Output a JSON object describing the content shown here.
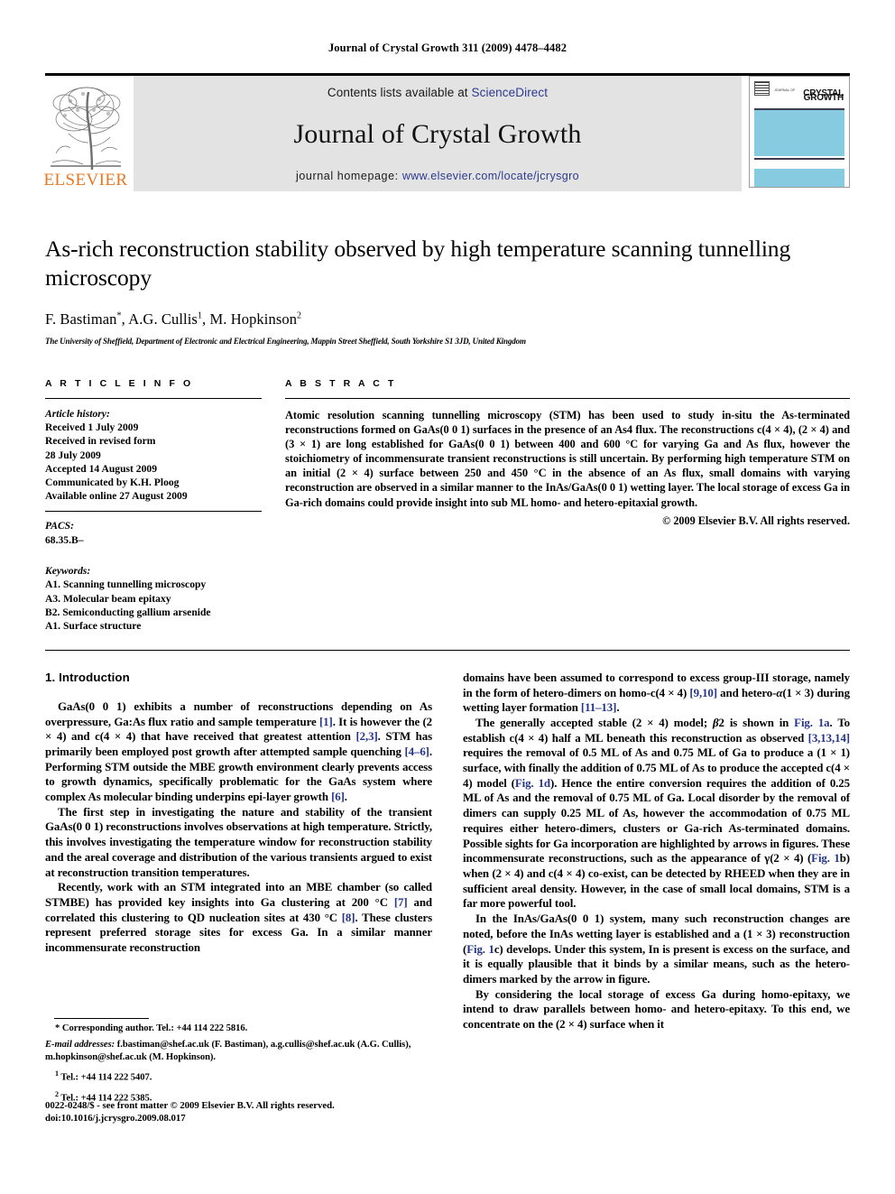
{
  "running_head": "Journal of Crystal Growth 311 (2009) 4478–4482",
  "masthead": {
    "publisher_name": "ELSEVIER",
    "contents_prefix": "Contents lists available at ",
    "contents_link": "ScienceDirect",
    "journal_name": "Journal of Crystal Growth",
    "homepage_prefix": "journal homepage: ",
    "homepage_link": "www.elsevier.com/locate/jcrysgro",
    "cover": {
      "kicker": "JOURNAL OF",
      "line1": "CRYSTAL",
      "line2": "GROWTH",
      "band_color": "#86cbe0"
    },
    "link_color": "#2b3a8f",
    "elsevier_orange": "#E87722"
  },
  "article": {
    "title": "As-rich reconstruction stability observed by high temperature scanning tunnelling microscopy",
    "authors_html": "F. Bastiman *, A.G. Cullis 1, M. Hopkinson 2",
    "affiliation": "The University of Sheffield, Department of Electronic and Electrical Engineering, Mappin Street Sheffield, South Yorkshire S1 3JD, United Kingdom"
  },
  "article_info": {
    "heading": "A R T I C L E    I N F O",
    "history_label": "Article history:",
    "history": [
      "Received 1 July 2009",
      "Received in revised form",
      "28 July 2009",
      "Accepted 14 August 2009",
      "Communicated by K.H. Ploog",
      "Available online 27 August 2009"
    ],
    "pacs_label": "PACS:",
    "pacs": [
      "68.35.B–"
    ],
    "keywords_label": "Keywords:",
    "keywords": [
      "A1. Scanning tunnelling microscopy",
      "A3. Molecular beam epitaxy",
      "B2. Semiconducting gallium arsenide",
      "A1. Surface structure"
    ]
  },
  "abstract": {
    "heading": "A B S T R A C T",
    "text": "Atomic resolution scanning tunnelling microscopy (STM) has been used to study in-situ the As-terminated reconstructions formed on GaAs(0 0 1) surfaces in the presence of an As4 flux. The reconstructions c(4 × 4), (2 × 4) and (3 × 1) are long established for GaAs(0 0 1) between 400 and 600 °C for varying Ga and As flux, however the stoichiometry of incommensurate transient reconstructions is still uncertain. By performing high temperature STM on an initial (2 × 4) surface between 250 and 450 °C in the absence of an As flux, small domains with varying reconstruction are observed in a similar manner to the InAs/GaAs(0 0 1) wetting layer. The local storage of excess Ga in Ga-rich domains could provide insight into sub ML homo- and hetero-epitaxial growth.",
    "copyright": "© 2009 Elsevier B.V. All rights reserved."
  },
  "body": {
    "section_heading": "1. Introduction",
    "left_paragraphs": [
      "GaAs(0 0 1) exhibits a number of reconstructions depending on As overpressure, Ga:As flux ratio and sample temperature [1]. It is however the (2 × 4) and c(4 × 4) that have received that greatest attention [2,3]. STM has primarily been employed post growth after attempted sample quenching [4–6]. Performing STM outside the MBE growth environment clearly prevents access to growth dynamics, specifically problematic for the GaAs system where complex As molecular binding underpins epi-layer growth [6].",
      "The first step in investigating the nature and stability of the transient GaAs(0 0 1) reconstructions involves observations at high temperature. Strictly, this involves investigating the temperature window for reconstruction stability and the areal coverage and distribution of the various transients argued to exist at reconstruction transition temperatures.",
      "Recently, work with an STM integrated into an MBE chamber (so called STMBE) has provided key insights into Ga clustering at 200 °C [7] and correlated this clustering to QD nucleation sites at 430 °C [8]. These clusters represent preferred storage sites for excess Ga. In a similar manner incommensurate reconstruction"
    ],
    "right_paragraphs": [
      "domains have been assumed to correspond to excess group-III storage, namely in the form of hetero-dimers on homo-c(4 × 4) [9,10] and hetero-α(1 × 3) during wetting layer formation [11–13].",
      "The generally accepted stable (2 × 4) model; β2 is shown in Fig. 1a. To establish c(4 × 4) half a ML beneath this reconstruction as observed [3,13,14] requires the removal of 0.5 ML of As and 0.75 ML of Ga to produce a (1 × 1) surface, with finally the addition of 0.75 ML of As to produce the accepted c(4 × 4) model (Fig. 1d). Hence the entire conversion requires the addition of 0.25 ML of As and the removal of 0.75 ML of Ga. Local disorder by the removal of dimers can supply 0.25 ML of As, however the accommodation of 0.75 ML requires either hetero-dimers, clusters or Ga-rich As-terminated domains. Possible sights for Ga incorporation are highlighted by arrows in figures. These incommensurate reconstructions, such as the appearance of γ(2 × 4) (Fig. 1b) when (2 × 4) and c(4 × 4) co-exist, can be detected by RHEED when they are in sufficient areal density. However, in the case of small local domains, STM is a far more powerful tool.",
      "In the InAs/GaAs(0 0 1) system, many such reconstruction changes are noted, before the InAs wetting layer is established and a (1 × 3) reconstruction (Fig. 1c) develops. Under this system, In is present is excess on the surface, and it is equally plausible that it binds by a similar means, such as the hetero-dimers marked by the arrow in figure.",
      "By considering the local storage of excess Ga during homo-epitaxy, we intend to draw parallels between homo- and hetero-epitaxy. To this end, we concentrate on the (2 × 4) surface when it"
    ]
  },
  "footnotes": {
    "corresponding": "* Corresponding author. Tel.: +44 114 222 5816.",
    "emails_label": "E-mail addresses:",
    "emails": "f.bastiman@shef.ac.uk (F. Bastiman), a.g.cullis@shef.ac.uk (A.G. Cullis), m.hopkinson@shef.ac.uk (M. Hopkinson).",
    "tel1_sup": "1",
    "tel1": "Tel.: +44 114 222 5407.",
    "tel2_sup": "2",
    "tel2": "Tel.: +44 114 222 5385."
  },
  "issn": {
    "line1": "0022-0248/$ - see front matter © 2009 Elsevier B.V. All rights reserved.",
    "line2": "doi:10.1016/j.jcrysgro.2009.08.017"
  }
}
